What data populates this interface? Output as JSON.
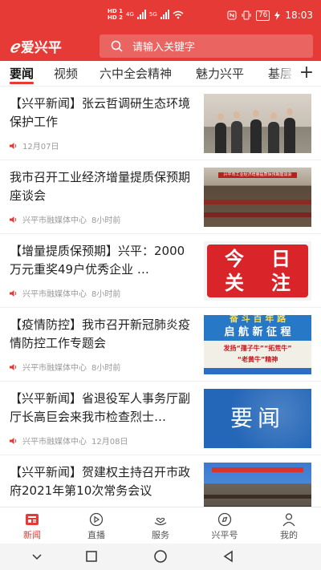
{
  "statusbar": {
    "hd1": "HD 1",
    "hd2": "HD 2",
    "net1": "4G",
    "net2": "5G",
    "battery": "76",
    "time": "18:03"
  },
  "header": {
    "logo_text": "爱兴平",
    "search_placeholder": "请输入关键字"
  },
  "tabs": [
    "要闻",
    "视频",
    "六中全会精神",
    "魅力兴平",
    "基层"
  ],
  "feed": [
    {
      "title": "【兴平新闻】张云哲调研生态环境保护工作",
      "source": "",
      "time": "12月07日"
    },
    {
      "title": "我市召开工业经济增量提质保预期座谈会",
      "source": "兴平市融媒体中心",
      "time": "8小时前",
      "thumb_banner": "兴平市工业经济增量提质保预期座谈会"
    },
    {
      "title": "【增量提质保预期】兴平：2000万元重奖49户优秀企业 …",
      "source": "兴平市融媒体中心",
      "time": "8小时前",
      "thumb_text": [
        "今",
        "日",
        "关",
        "注"
      ]
    },
    {
      "title": "【疫情防控】我市召开新冠肺炎疫情防控工作专题会",
      "source": "兴平市融媒体中心",
      "time": "8小时前",
      "thumb_top": "奋 斗 百 年 路",
      "thumb_mid": "启 航 新 征 程",
      "thumb_line1": "发扬“孺子牛”“拓荒牛”",
      "thumb_line2": "“老黄牛”精神"
    },
    {
      "title": "【兴平新闻】省退役军人事务厅副厅长高巨会来我市检查烈士…",
      "source": "兴平市融媒体中心",
      "time": "12月08日",
      "thumb_text": "要闻"
    },
    {
      "title": "【兴平新闻】贺建权主持召开市政府2021年第10次常务会议",
      "source": "",
      "time": ""
    }
  ],
  "bottomnav": [
    "新闻",
    "直播",
    "服务",
    "兴平号",
    "我的"
  ],
  "colors": {
    "brand": "#e53a35",
    "text": "#222222",
    "meta": "#999999"
  }
}
